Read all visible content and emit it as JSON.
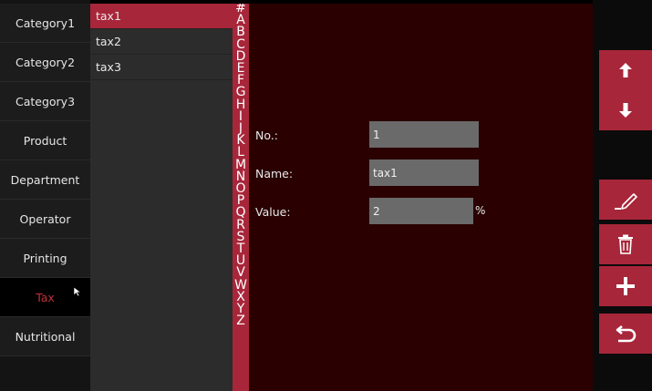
{
  "sidebar": {
    "items": [
      {
        "label": "Category1"
      },
      {
        "label": "Category2"
      },
      {
        "label": "Category3"
      },
      {
        "label": "Product"
      },
      {
        "label": "Department"
      },
      {
        "label": "Operator"
      },
      {
        "label": "Printing"
      },
      {
        "label": "Tax"
      },
      {
        "label": "Nutritional"
      }
    ],
    "active": "Tax"
  },
  "list": {
    "items": [
      {
        "label": "tax1"
      },
      {
        "label": "tax2"
      },
      {
        "label": "tax3"
      }
    ],
    "selected": "tax1"
  },
  "alphabet": [
    "#",
    "A",
    "B",
    "C",
    "D",
    "E",
    "F",
    "G",
    "H",
    "I",
    "J",
    "K",
    "L",
    "M",
    "N",
    "O",
    "P",
    "Q",
    "R",
    "S",
    "T",
    "U",
    "V",
    "W",
    "X",
    "Y",
    "Z"
  ],
  "form": {
    "no_label": "No.:",
    "no_value": "1",
    "name_label": "Name:",
    "name_value": "tax1",
    "value_label": "Value:",
    "value_value": "2",
    "value_unit": "%"
  },
  "toolbar": {
    "buttons": [
      "move-up-icon",
      "move-down-icon",
      "edit-icon",
      "delete-icon",
      "add-icon",
      "back-icon"
    ]
  },
  "colors": {
    "accent": "#a8263a",
    "main_bg": "#2a0000",
    "active_text": "#c0303a"
  }
}
